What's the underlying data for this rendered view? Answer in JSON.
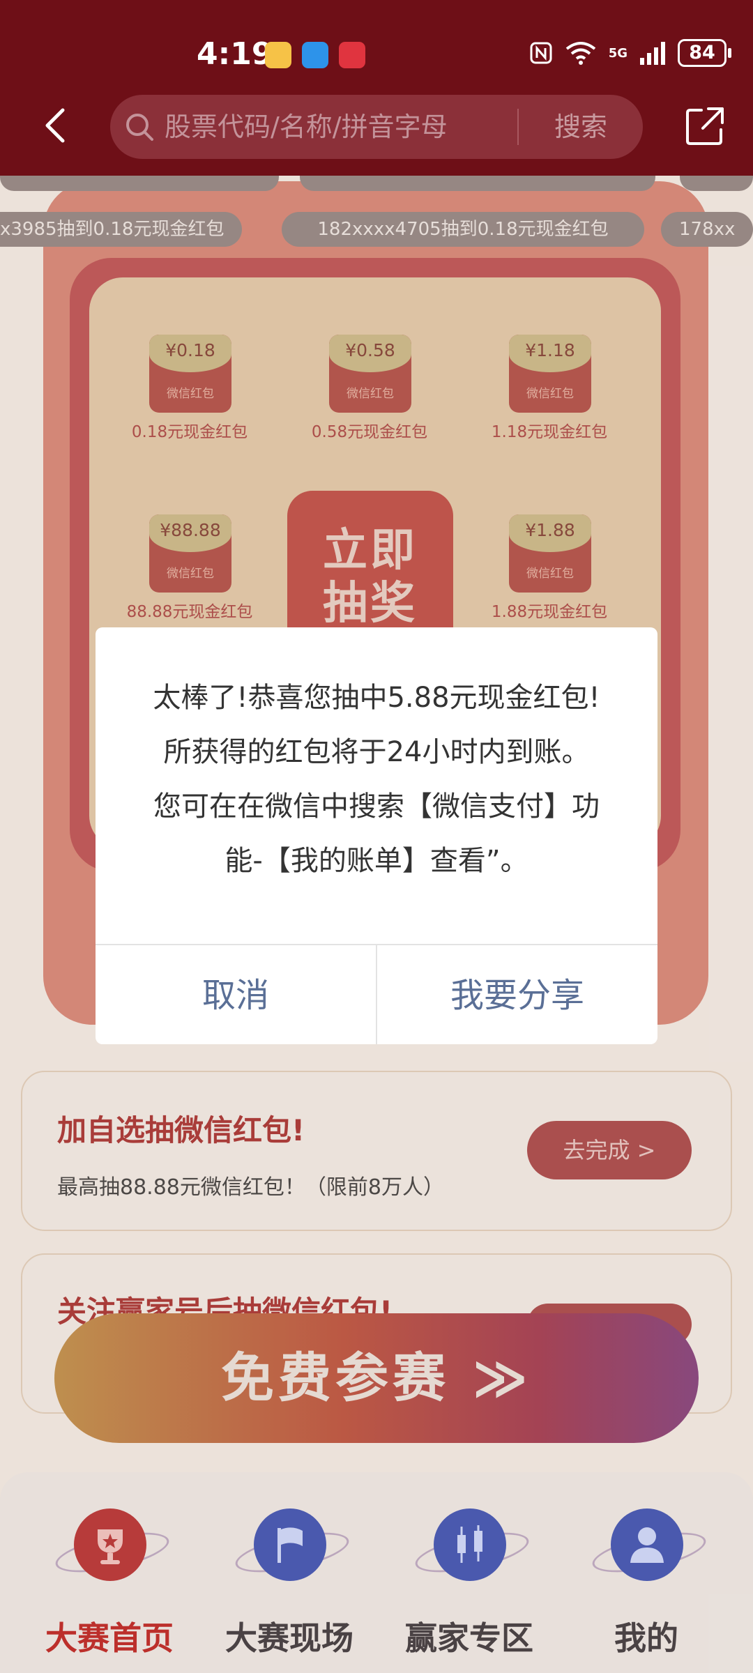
{
  "status_bar": {
    "time": "4:19",
    "network": "5G",
    "battery": "84"
  },
  "header": {
    "search_placeholder": "股票代码/名称/拼音字母",
    "search_button": "搜索"
  },
  "marquee": [
    "x3985抽到0.18元现金红包",
    "182xxxx4705抽到0.18元现金红包",
    "178xx"
  ],
  "lottery": {
    "prizes": [
      {
        "amount": "¥0.18",
        "tag": "微信红包",
        "label": "0.18元现金红包"
      },
      {
        "amount": "¥0.58",
        "tag": "微信红包",
        "label": "0.58元现金红包"
      },
      {
        "amount": "¥1.18",
        "tag": "微信红包",
        "label": "1.18元现金红包"
      },
      {
        "amount": "¥88.88",
        "tag": "微信红包",
        "label": "88.88元现金红包"
      },
      {
        "amount": "¥1.88",
        "tag": "微信红包",
        "label": "1.88元现金红包"
      }
    ],
    "draw_button_line1": "立即",
    "draw_button_line2": "抽奖"
  },
  "tasks": [
    {
      "title": "加自选抽微信红包!",
      "desc": "最高抽88.88元微信红包！（限前8万人）",
      "button": "去完成 >"
    },
    {
      "title": "关注赢家号后抽微信红包!",
      "desc": "",
      "button": ""
    }
  ],
  "free_entry_button": "免费参赛 ≫",
  "bottom_nav": [
    {
      "label": "大赛首页",
      "active": true
    },
    {
      "label": "大赛现场",
      "active": false
    },
    {
      "label": "赢家专区",
      "active": false
    },
    {
      "label": "我的",
      "active": false
    }
  ],
  "dialog": {
    "line1": "太棒了!恭喜您抽中5.88元现金红包!",
    "line2": "所获得的红包将于24小时内到账。",
    "line3": "您可在在微信中搜索【微信支付】功",
    "line4": "能-【我的账单】查看”。",
    "cancel": "取消",
    "share": "我要分享"
  },
  "colors": {
    "header": "#6e0f17",
    "dialog_button_text": "#5a6f96",
    "active_nav": "#c0302c"
  }
}
